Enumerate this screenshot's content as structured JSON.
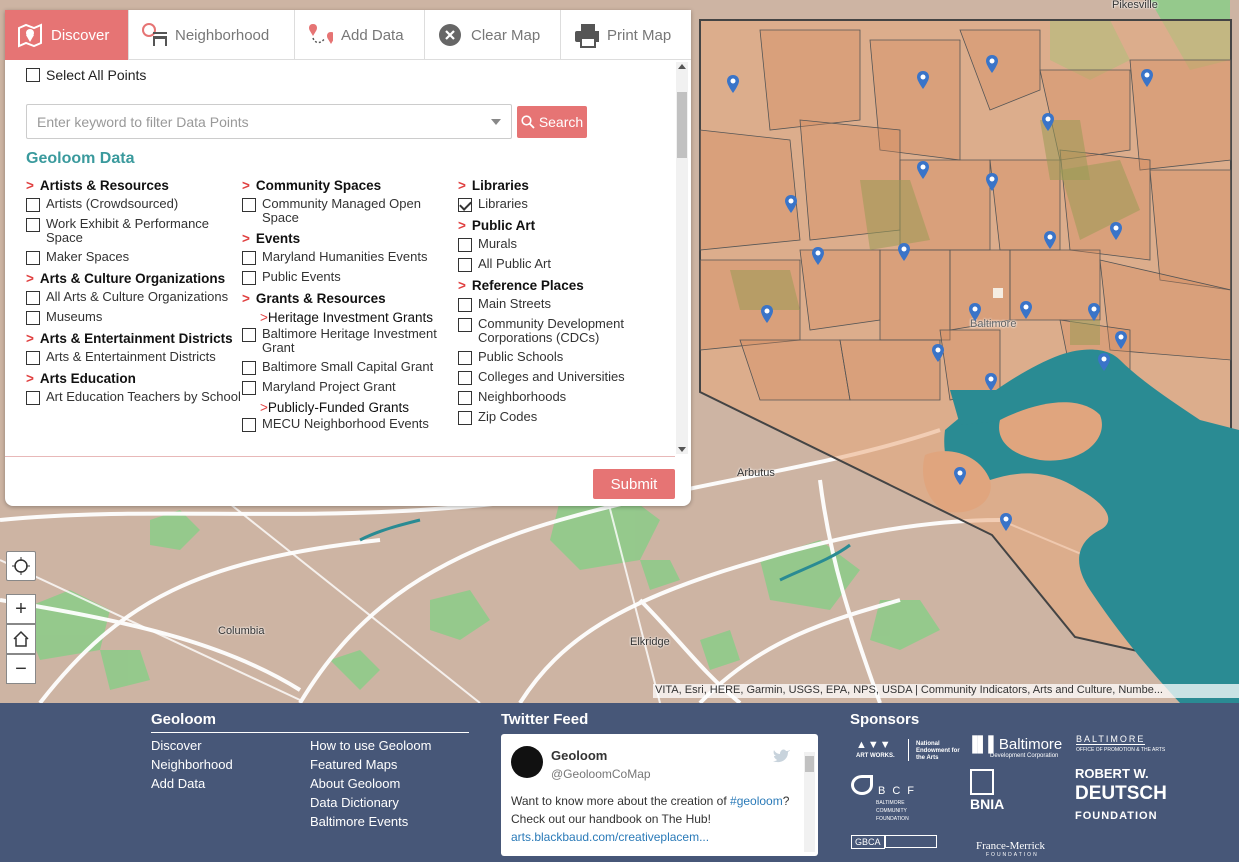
{
  "tabs": [
    {
      "label": "Discover",
      "icon": "map-pin-icon",
      "active": true
    },
    {
      "label": "Neighborhood",
      "icon": "park-bench-icon"
    },
    {
      "label": "Add Data",
      "icon": "route-pins-icon"
    },
    {
      "label": "Clear Map",
      "icon": "close-circle-icon"
    },
    {
      "label": "Print Map",
      "icon": "printer-icon"
    }
  ],
  "panel": {
    "select_all_label": "Select All Points",
    "filter_placeholder": "Enter keyword to filter Data Points",
    "search_label": "Search",
    "section_title": "Geoloom Data",
    "submit_label": "Submit",
    "columns": [
      [
        {
          "type": "cat",
          "label": "Artists & Resources"
        },
        {
          "type": "item",
          "label": "Artists (Crowdsourced)",
          "checked": false
        },
        {
          "type": "item",
          "label": "Work Exhibit & Performance Space",
          "checked": false
        },
        {
          "type": "item",
          "label": "Maker Spaces",
          "checked": false
        },
        {
          "type": "cat",
          "label": "Arts & Culture Organizations"
        },
        {
          "type": "item",
          "label": "All Arts & Culture Organizations",
          "checked": false
        },
        {
          "type": "item",
          "label": "Museums",
          "checked": false
        },
        {
          "type": "cat",
          "label": "Arts & Entertainment Districts"
        },
        {
          "type": "item",
          "label": "Arts & Entertainment Districts",
          "checked": false
        },
        {
          "type": "cat",
          "label": "Arts Education"
        },
        {
          "type": "item",
          "label": "Art Education Teachers by School",
          "checked": false
        }
      ],
      [
        {
          "type": "cat",
          "label": "Community Spaces"
        },
        {
          "type": "item",
          "label": "Community Managed Open Space",
          "checked": false
        },
        {
          "type": "cat",
          "label": "Events"
        },
        {
          "type": "item",
          "label": "Maryland Humanities Events",
          "checked": false
        },
        {
          "type": "item",
          "label": "Public Events",
          "checked": false
        },
        {
          "type": "cat",
          "label": "Grants & Resources"
        },
        {
          "type": "sub",
          "label": "Heritage Investment Grants"
        },
        {
          "type": "item",
          "label": "Baltimore Heritage Investment Grant",
          "checked": false
        },
        {
          "type": "item",
          "label": "Baltimore Small Capital Grant",
          "checked": false
        },
        {
          "type": "item",
          "label": "Maryland Project Grant",
          "checked": false
        },
        {
          "type": "sub",
          "label": "Publicly-Funded Grants"
        },
        {
          "type": "item",
          "label": "MECU Neighborhood Events",
          "checked": false
        }
      ],
      [
        {
          "type": "cat",
          "label": "Libraries"
        },
        {
          "type": "item",
          "label": "Libraries",
          "checked": true
        },
        {
          "type": "cat",
          "label": "Public Art"
        },
        {
          "type": "item",
          "label": "Murals",
          "checked": false
        },
        {
          "type": "item",
          "label": "All Public Art",
          "checked": false
        },
        {
          "type": "cat",
          "label": "Reference Places"
        },
        {
          "type": "item",
          "label": "Main Streets",
          "checked": false
        },
        {
          "type": "item",
          "label": "Community Development Corporations (CDCs)",
          "checked": false
        },
        {
          "type": "item",
          "label": "Public Schools",
          "checked": false
        },
        {
          "type": "item",
          "label": "Colleges and Universities",
          "checked": false
        },
        {
          "type": "item",
          "label": "Neighborhoods",
          "checked": false
        },
        {
          "type": "item",
          "label": "Zip Codes",
          "checked": false
        }
      ]
    ]
  },
  "map": {
    "places": [
      "Pikesville",
      "Baltimore",
      "Arbutus",
      "Columbia",
      "Elkridge"
    ],
    "attribution": "VITA, Esri, HERE, Garmin, USGS, EPA, NPS, USDA | Community Indicators, Arts and Culture, Numbe..."
  },
  "footer": {
    "geoloom_title": "Geoloom",
    "links_left": [
      "Discover",
      "Neighborhood",
      "Add Data"
    ],
    "links_right": [
      "How to use Geoloom",
      "Featured Maps",
      "About Geoloom",
      "Data Dictionary",
      "Baltimore Events"
    ],
    "twitter_title": "Twitter Feed",
    "tweet": {
      "name": "Geoloom",
      "handle": "@GeoloomCoMap",
      "text_before": "Want to know more about the creation of ",
      "hashtag": "#geoloom",
      "text_after": "? Check out our handbook on The Hub!",
      "link": "arts.blackbaud.com/creativeplacem..."
    },
    "sponsors_title": "Sponsors",
    "sponsors": [
      "ART WORKS.",
      "National Endowment for the Arts",
      "Baltimore",
      "Development Corporation",
      "BALTIMORE",
      "OFFICE OF PROMOTION & THE ARTS",
      "BCF",
      "BALTIMORE COMMUNITY FOUNDATION",
      "BNIA",
      "ROBERT W.",
      "DEUTSCH",
      "FOUNDATION",
      "GBCA",
      "France-Merrick",
      "FOUNDATION"
    ]
  }
}
